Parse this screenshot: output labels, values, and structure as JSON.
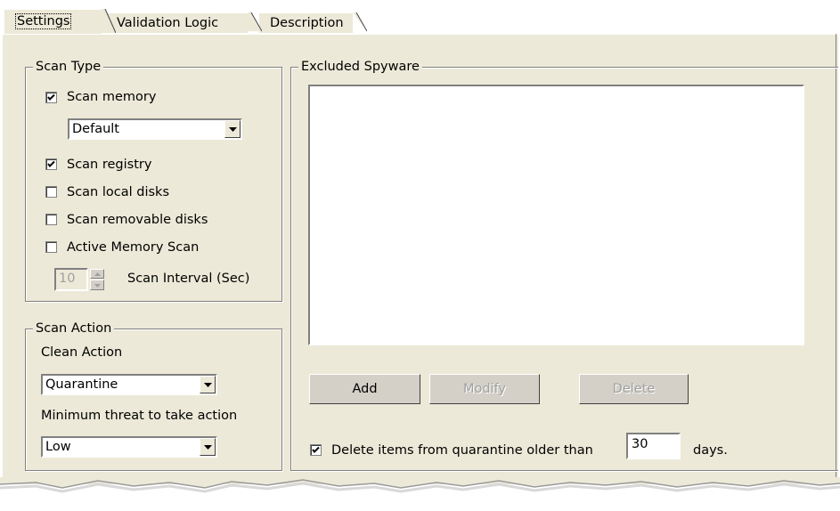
{
  "tabs": [
    {
      "label": "Settings",
      "active": true
    },
    {
      "label": "Validation Logic",
      "active": false
    },
    {
      "label": "Description",
      "active": false
    }
  ],
  "scan_type": {
    "title": "Scan Type",
    "scan_memory": {
      "label": "Scan memory",
      "checked": true
    },
    "memory_mode": {
      "value": "Default"
    },
    "scan_registry": {
      "label": "Scan registry",
      "checked": true
    },
    "scan_local_disks": {
      "label": "Scan local disks",
      "checked": false
    },
    "scan_removable_disks": {
      "label": "Scan removable disks",
      "checked": false
    },
    "active_memory_scan": {
      "label": "Active Memory Scan",
      "checked": false
    },
    "scan_interval": {
      "value": "10",
      "label": "Scan Interval (Sec)",
      "enabled": false
    }
  },
  "scan_action": {
    "title": "Scan Action",
    "clean_action_label": "Clean Action",
    "clean_action_value": "Quarantine",
    "min_threat_label": "Minimum threat to take action",
    "min_threat_value": "Low"
  },
  "excluded": {
    "title": "Excluded Spyware",
    "items": [],
    "add_label": "Add",
    "modify_label": "Modify",
    "delete_label": "Delete"
  },
  "quarantine": {
    "checked": true,
    "label": "Delete items from quarantine older than",
    "days_value": "30",
    "days_suffix": "days."
  },
  "colors": {
    "panel": "#ece9d8",
    "button_face": "#d4d0c8",
    "border_dark": "#808080"
  }
}
